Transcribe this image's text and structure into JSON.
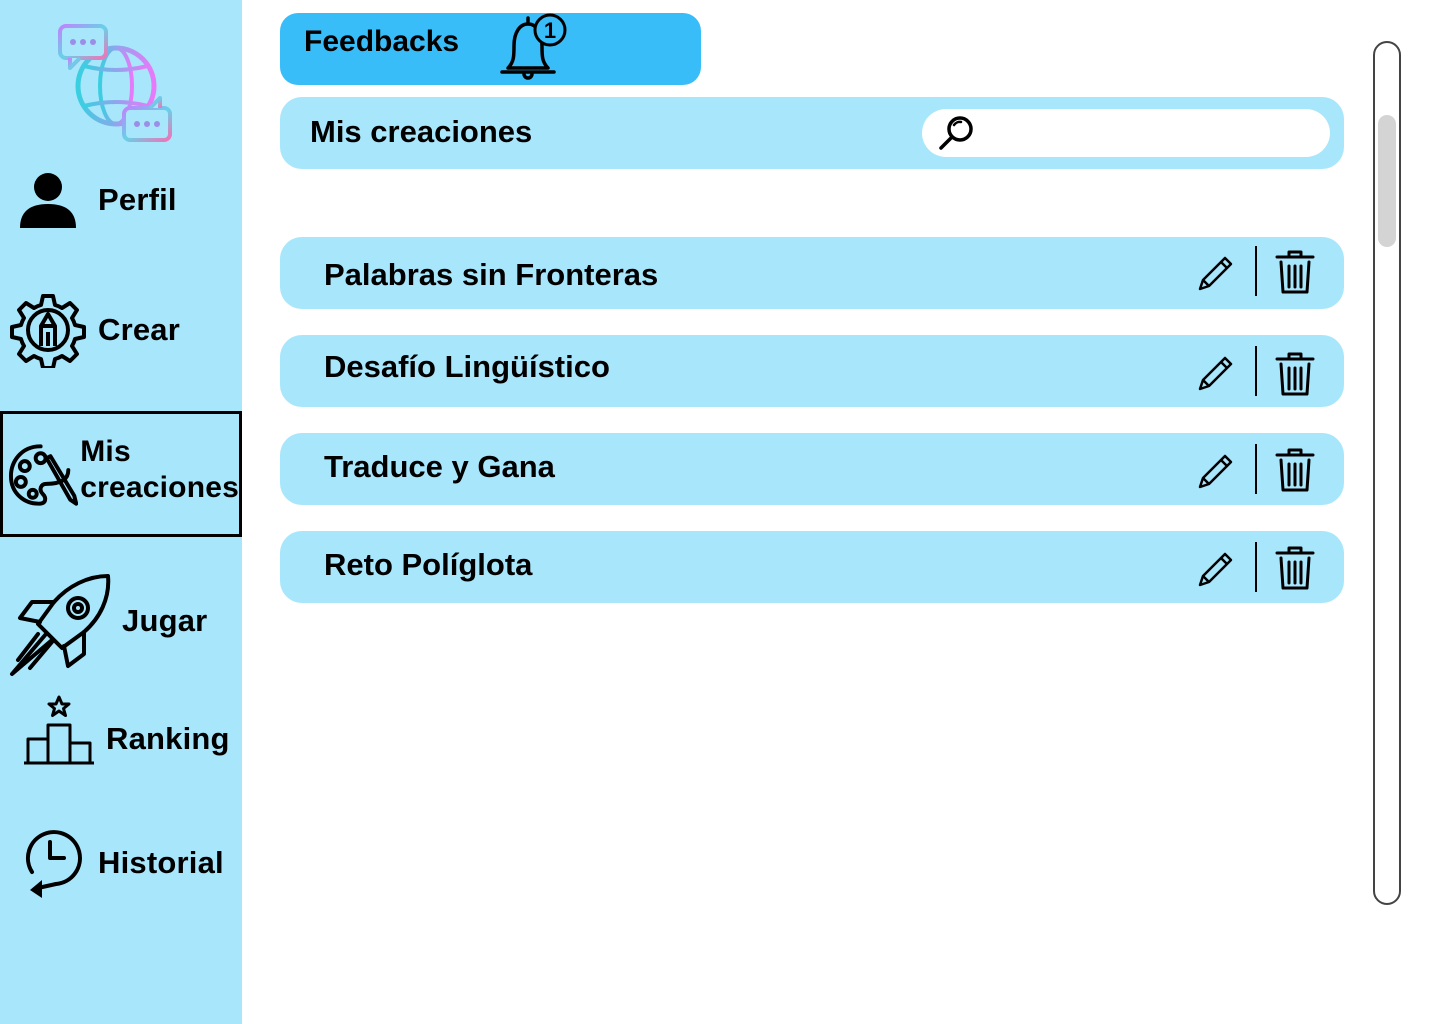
{
  "sidebar": {
    "logo": "globe-chat-logo",
    "items": [
      {
        "label": "Perfil",
        "icon": "user-icon"
      },
      {
        "label": "Crear",
        "icon": "gear-pencil-icon"
      },
      {
        "label": "Mis\ncreaciones",
        "icon": "palette-icon",
        "active": true
      },
      {
        "label": "Jugar",
        "icon": "rocket-icon"
      },
      {
        "label": "Ranking",
        "icon": "podium-icon"
      },
      {
        "label": "Historial",
        "icon": "history-clock-icon"
      }
    ]
  },
  "feedbacks": {
    "label": "Feedbacks",
    "notification_count": "1",
    "icon": "bell-icon"
  },
  "header": {
    "title": "Mis creaciones",
    "search": {
      "placeholder": "",
      "value": "",
      "icon": "search-icon"
    }
  },
  "creations": [
    {
      "title": "Palabras sin Fronteras"
    },
    {
      "title": "Desafío Lingüístico"
    },
    {
      "title": "Traduce y Gana"
    },
    {
      "title": "Reto Políglota"
    }
  ],
  "colors": {
    "sidebar_bg": "#a8e6fc",
    "row_bg": "#a8e6fc",
    "feedbacks_bg": "#38bdf8"
  }
}
